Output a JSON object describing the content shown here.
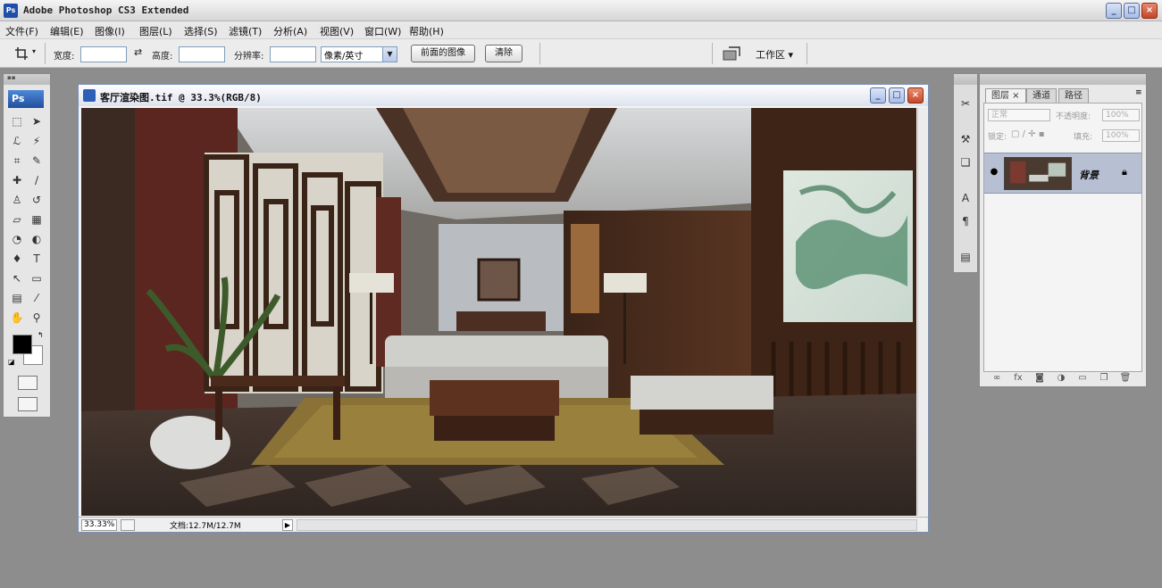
{
  "app": {
    "title": "Adobe Photoshop CS3 Extended",
    "icon_label": "Ps",
    "window_controls": [
      "_",
      "□",
      "×"
    ]
  },
  "menu": {
    "items": [
      "文件(F)",
      "编辑(E)",
      "图像(I)",
      "图层(L)",
      "选择(S)",
      "滤镜(T)",
      "分析(A)",
      "视图(V)",
      "窗口(W)",
      "帮助(H)"
    ]
  },
  "options_bar": {
    "tool_icon": "crop-icon",
    "width_label": "宽度:",
    "width_value": "",
    "swap_icon": "swap-arrows-icon",
    "height_label": "高度:",
    "height_value": "",
    "resolution_label": "分辨率:",
    "resolution_value": "",
    "unit_select": "像素/英寸",
    "front_image_button": "前面的图像",
    "clear_button": "清除",
    "workspace_label": "工作区 ▾"
  },
  "toolbox": {
    "logo": "Ps",
    "tools": [
      {
        "name": "marquee-icon",
        "glyph": "⬚"
      },
      {
        "name": "move-icon",
        "glyph": "➤"
      },
      {
        "name": "lasso-icon",
        "glyph": "ℒ"
      },
      {
        "name": "magic-wand-icon",
        "glyph": "⚡"
      },
      {
        "name": "crop-icon",
        "glyph": "⌗"
      },
      {
        "name": "slice-icon",
        "glyph": "✎"
      },
      {
        "name": "healing-brush-icon",
        "glyph": "✚"
      },
      {
        "name": "brush-icon",
        "glyph": "∕"
      },
      {
        "name": "clone-stamp-icon",
        "glyph": "♙"
      },
      {
        "name": "history-brush-icon",
        "glyph": "↺"
      },
      {
        "name": "eraser-icon",
        "glyph": "▱"
      },
      {
        "name": "gradient-icon",
        "glyph": "▦"
      },
      {
        "name": "blur-icon",
        "glyph": "◔"
      },
      {
        "name": "dodge-icon",
        "glyph": "◐"
      },
      {
        "name": "pen-icon",
        "glyph": "♦"
      },
      {
        "name": "type-icon",
        "glyph": "T"
      },
      {
        "name": "path-selection-icon",
        "glyph": "↖"
      },
      {
        "name": "shape-icon",
        "glyph": "▭"
      },
      {
        "name": "notes-icon",
        "glyph": "▤"
      },
      {
        "name": "eyedropper-icon",
        "glyph": "⁄"
      },
      {
        "name": "hand-icon",
        "glyph": "✋"
      },
      {
        "name": "zoom-icon",
        "glyph": "⚲"
      }
    ],
    "foreground_color": "#000000",
    "background_color": "#ffffff"
  },
  "document": {
    "title": "客厅渲染图.tif @ 33.3%(RGB/8)",
    "zoom": "33.33%",
    "doc_size": "文档:12.7M/12.7M",
    "status_arrow": "▶"
  },
  "layers_panel": {
    "tabs": [
      "图层 ×",
      "通道",
      "路径"
    ],
    "blend_mode": "正常",
    "opacity_label": "不透明度:",
    "opacity_value": "100%",
    "lock_label": "锁定:",
    "fill_label": "填充:",
    "fill_value": "100%",
    "layer_name": "背景",
    "footer_icons": [
      "link-icon",
      "fx-icon",
      "mask-icon",
      "adjustment-icon",
      "folder-icon",
      "new-layer-icon",
      "trash-icon"
    ]
  },
  "dock": {
    "icons": [
      "brush-presets-icon",
      "tool-presets-icon",
      "layer-comps-icon",
      "character-icon",
      "paragraph-icon",
      "navigator-icon"
    ]
  }
}
